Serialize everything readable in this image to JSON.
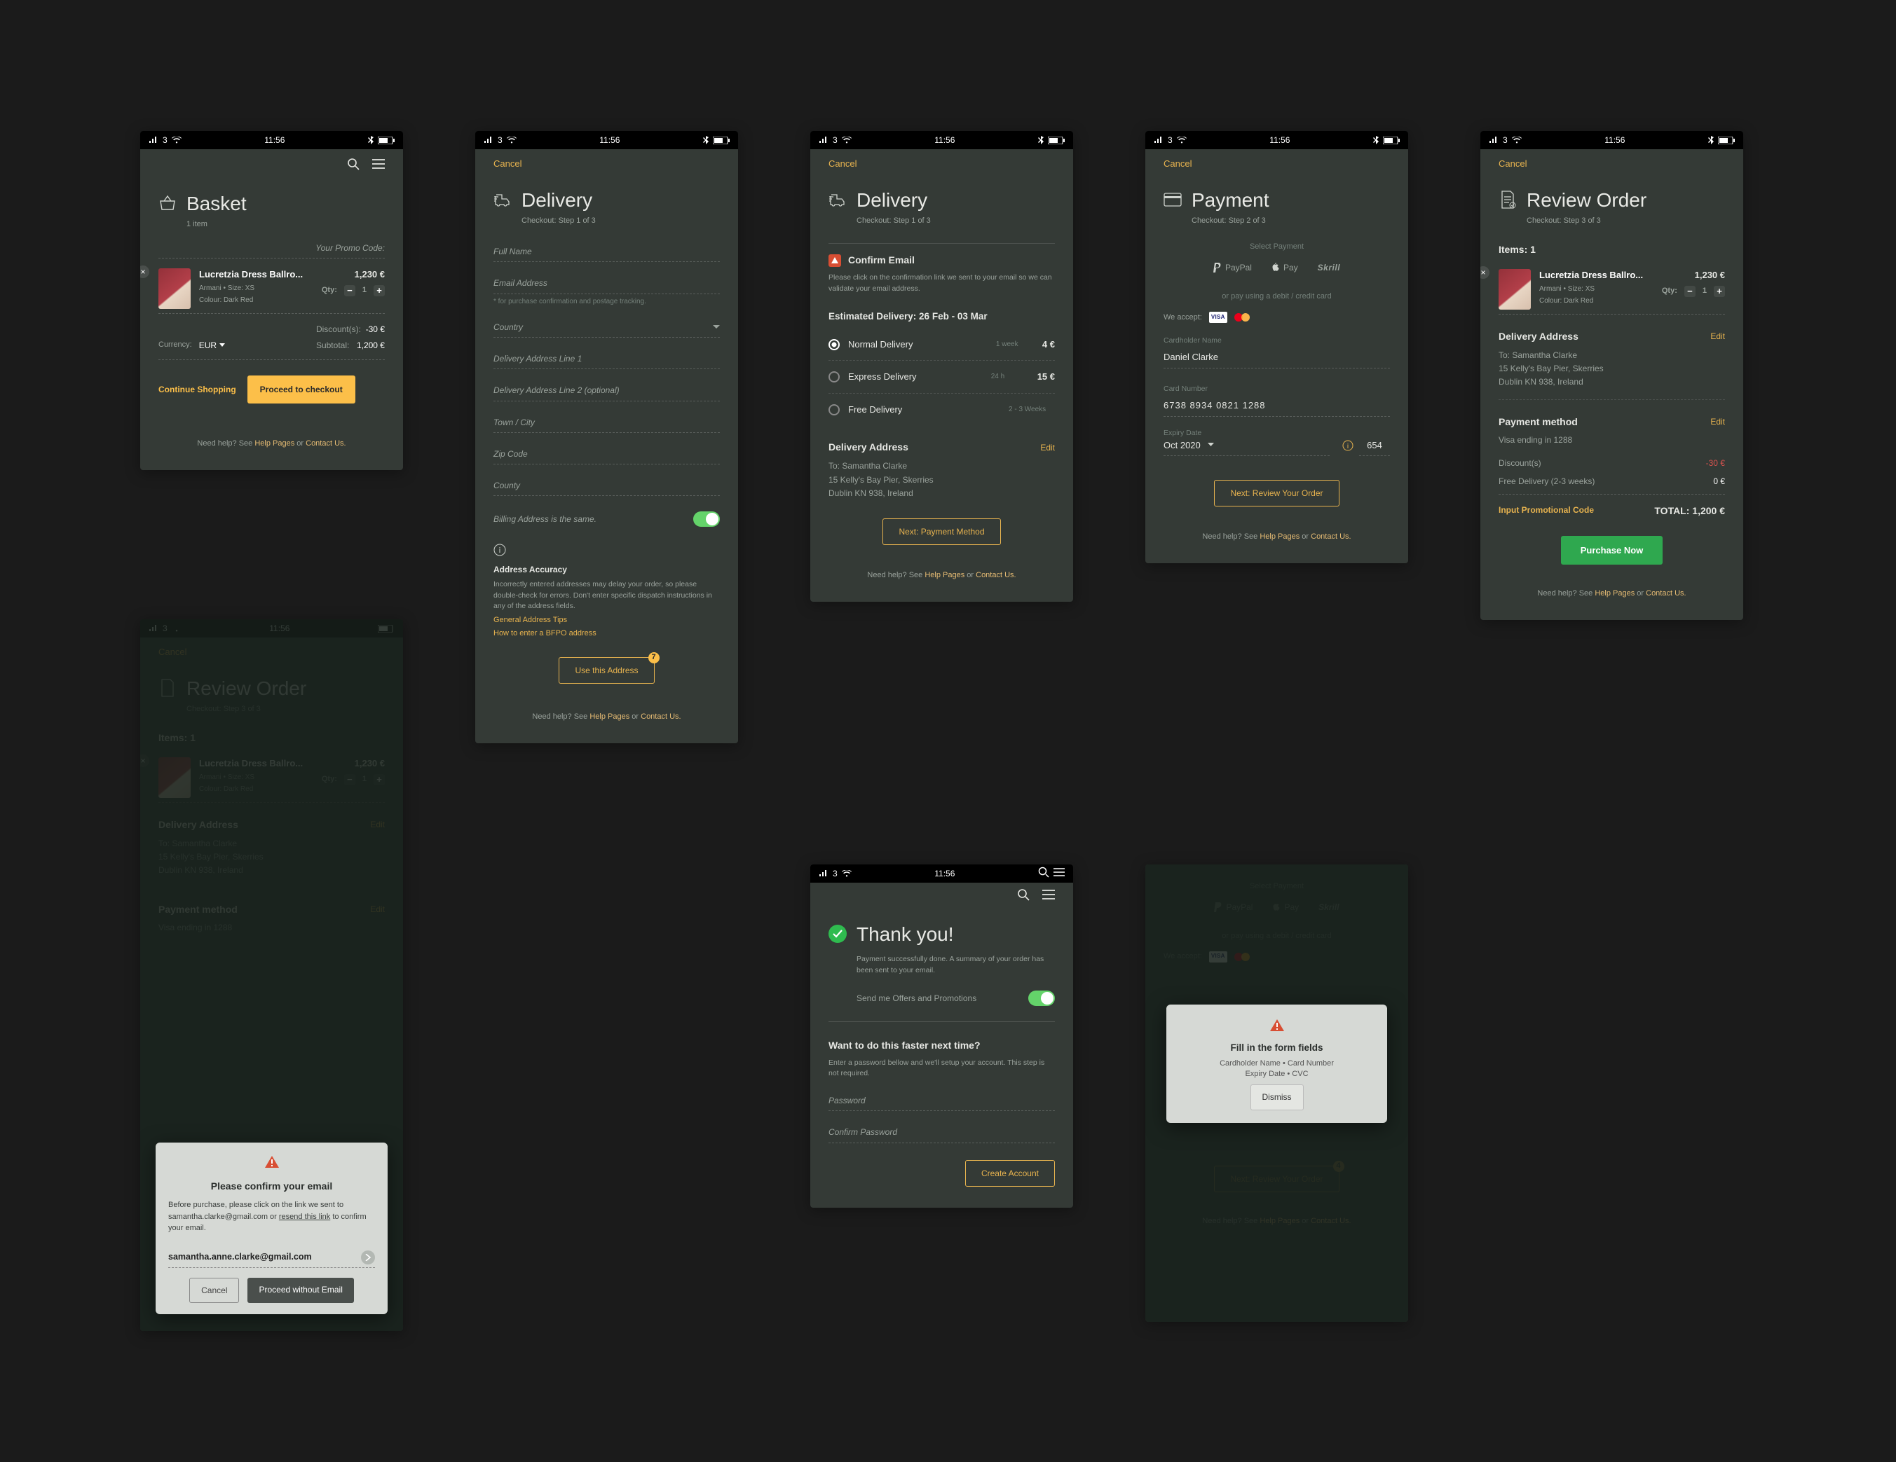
{
  "statusbar": {
    "carrier": "3",
    "time": "11:56"
  },
  "common": {
    "cancel": "Cancel",
    "help_prefix": "Need help? See ",
    "help_pages": "Help Pages",
    "help_or": " or ",
    "contact_us": "Contact Us."
  },
  "product": {
    "name": "Lucretzia Dress Ballro...",
    "brand_size": "Armani  •  Size: XS",
    "colour": "Colour: Dark Red",
    "price": "1,230 €",
    "qty_label": "Qty:",
    "qty": "1"
  },
  "basket": {
    "title": "Basket",
    "subtitle": "1 item",
    "promo_label": "Your Promo Code:",
    "discount_label": "Discount(s):",
    "discount_value": "-30 €",
    "subtotal_label": "Subtotal:",
    "subtotal_value": "1,200 €",
    "currency_label": "Currency:",
    "currency_value": "EUR",
    "continue": "Continue Shopping",
    "checkout": "Proceed to checkout"
  },
  "delivery_form": {
    "title": "Delivery",
    "subtitle": "Checkout: Step 1 of 3",
    "full_name": "Full Name",
    "email": "Email Address",
    "email_note": "* for purchase confirmation and postage tracking.",
    "country": "Country",
    "addr1": "Delivery Address Line 1",
    "addr2": "Delivery Address Line 2 (optional)",
    "town": "Town / City",
    "zip": "Zip Code",
    "county": "County",
    "billing_same": "Billing Address is the same.",
    "accuracy_title": "Address Accuracy",
    "accuracy_body": "Incorrectly entered addresses may delay your order, so please double-check for errors. Don't enter specific dispatch instructions in any of the address fields.",
    "tips1": "General Address Tips",
    "tips2": "How to enter a BFPO address",
    "use_btn": "Use this Address"
  },
  "delivery_confirm": {
    "title": "Delivery",
    "subtitle": "Checkout: Step 1 of 3",
    "confirm_email": "Confirm Email",
    "confirm_body": "Please click on the confirmation link we sent to your email so we can validate your email address.",
    "est_title": "Estimated Delivery: 26 Feb - 03 Mar",
    "options": [
      {
        "name": "Normal Delivery",
        "sub": "1 week",
        "price": "4 €",
        "on": true
      },
      {
        "name": "Express Delivery",
        "sub": "24 h",
        "price": "15 €",
        "on": false
      },
      {
        "name": "Free Delivery",
        "sub": "2 - 3 Weeks",
        "price": "",
        "on": false
      }
    ],
    "addr_title": "Delivery Address",
    "edit": "Edit",
    "addr_line1": "To: Samantha Clarke",
    "addr_line2": "15 Kelly's Bay Pier, Skerries",
    "addr_line3": "Dublin KN 938, Ireland",
    "next_btn": "Next: Payment Method"
  },
  "payment": {
    "title": "Payment",
    "subtitle": "Checkout: Step 2 of 3",
    "select": "Select Payment",
    "paypal": "PayPal",
    "apple": "Pay",
    "skrill": "Skrill",
    "or_card": "or pay using a debit / credit card",
    "accept": "We accept:",
    "cardholder_lbl": "Cardholder Name",
    "cardholder_val": "Daniel Clarke",
    "cardnum_lbl": "Card Number",
    "cardnum_val": "6738   8934   0821   1288",
    "expiry_lbl": "Expiry Date",
    "expiry_val": "Oct 2020",
    "cvc_val": "654",
    "next_btn": "Next: Review Your Order"
  },
  "review": {
    "title": "Review Order",
    "subtitle": "Checkout: Step 3 of 3",
    "items_h": "Items: 1",
    "addr_title": "Delivery Address",
    "addr_line1": "To: Samantha Clarke",
    "addr_line2": "15 Kelly's Bay Pier, Skerries",
    "addr_line3": "Dublin KN 938, Ireland",
    "paymethod_title": "Payment method",
    "paymethod_val": "Visa ending in 1288",
    "discount_lbl": "Discount(s)",
    "discount_val": "-30 €",
    "free_del_lbl": "Free Delivery (2-3 weeks)",
    "free_del_val": "0 €",
    "promo_input": "Input Promotional Code",
    "total_lbl": "TOTAL: 1,200 €",
    "purchase_btn": "Purchase Now",
    "edit": "Edit"
  },
  "review_modal": {
    "title": "Please confirm your email",
    "body_1": "Before purchase, please click on the link we sent to samantha.clarke@gmail.com or ",
    "resend": "resend this link",
    "body_2": " to confirm your email.",
    "email_val": "samantha.anne.clarke@gmail.com",
    "cancel": "Cancel",
    "proceed": "Proceed without Email"
  },
  "thankyou": {
    "title": "Thank you!",
    "body": "Payment successfully done. A summary of your order has been sent to your email.",
    "offers": "Send me Offers and Promotions",
    "faster_h": "Want to do this faster next time?",
    "faster_body": "Enter a password bellow and we'll setup your account. This step is not required.",
    "password": "Password",
    "confirm_password": "Confirm Password",
    "create_btn": "Create Account"
  },
  "payment_error": {
    "title": "Fill in the form fields",
    "line1": "Cardholder Name  •  Card Number",
    "line2": "Expiry Date  •  CVC",
    "dismiss": "Dismiss",
    "next_btn": "Next: Review Your Order"
  }
}
